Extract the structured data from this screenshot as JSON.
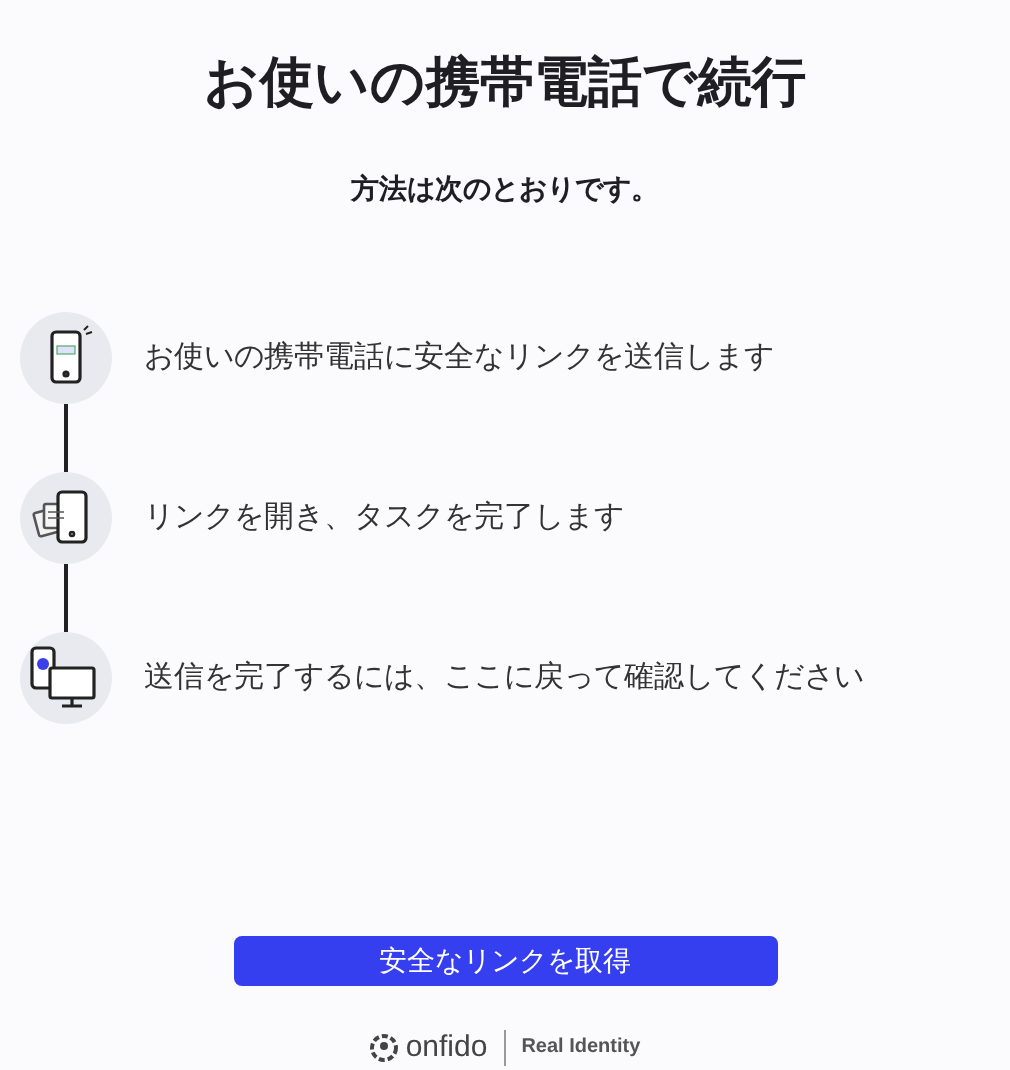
{
  "title": "お使いの携帯電話で続行",
  "subtitle": "方法は次のとおりです。",
  "steps": [
    {
      "kind": "phone",
      "text": "お使いの携帯電話に安全なリンクを送信します"
    },
    {
      "kind": "documents",
      "text": "リンクを開き、タスクを完了します"
    },
    {
      "kind": "devices",
      "text": "送信を完了するには、ここに戻って確認してください"
    }
  ],
  "button": "安全なリンクを取得",
  "footer": {
    "brand": "onfido",
    "tagline": "Real Identity"
  }
}
